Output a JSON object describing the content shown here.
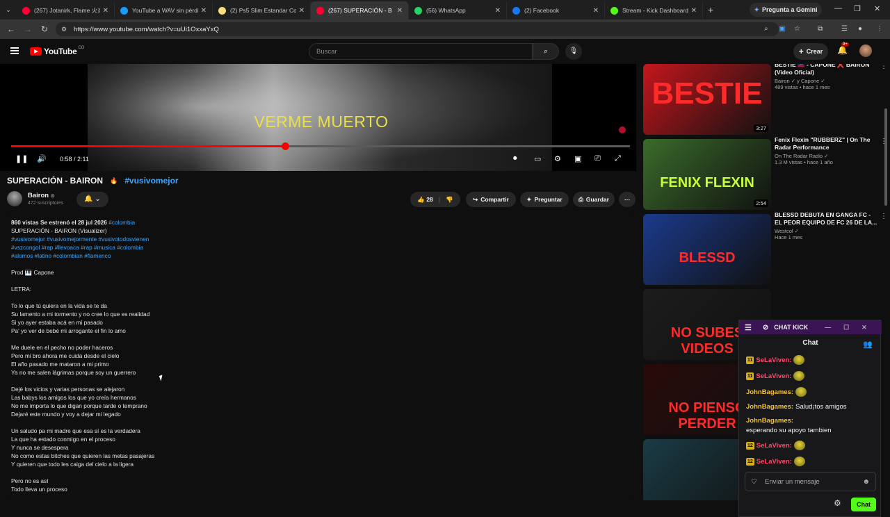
{
  "browser": {
    "tabs": [
      {
        "title": "(267) Jotanirk, Flame 火炎",
        "color": "#ff0033",
        "active": false
      },
      {
        "title": "YouTube a WAV sin pérdid",
        "color": "#1a9bfc",
        "active": false
      },
      {
        "title": "(2) Ps5 Slim Estandar Con",
        "color": "#f4e27a",
        "active": false
      },
      {
        "title": "(267) SUPERACIÓN - B",
        "color": "#ff0033",
        "active": true
      },
      {
        "title": "(56) WhatsApp",
        "color": "#25d366",
        "active": false
      },
      {
        "title": "(2) Facebook",
        "color": "#1877f2",
        "active": false
      },
      {
        "title": "Stream - Kick Dashboard",
        "color": "#53fc18",
        "active": false
      }
    ],
    "gemini_label": "Pregunta a Gemini",
    "url": "https://www.youtube.com/watch?v=uUi1OxxaYxQ"
  },
  "youtube": {
    "logo_text": "YouTube",
    "logo_country": "CO",
    "search_placeholder": "Buscar",
    "create_label": "Crear",
    "notif_count": "9+"
  },
  "player": {
    "lyric_overlay": "VERME MUERTO",
    "time": "0:58 / 2:11",
    "progress": 0.443
  },
  "video": {
    "title": "SUPERACIÓN - BAIRON",
    "hashtag": "#vusivomejor",
    "channel": "Bairon",
    "subscribers": "472 suscriptores",
    "likes": "28",
    "share_label": "Compartir",
    "ask_label": "Preguntar",
    "save_label": "Guardar"
  },
  "description": {
    "meta": "860 vistas  Se estrenó el 28 jul 2026",
    "meta_tag": "#colombia",
    "title_line": "SUPERACIÓN - BAIRON (Visualizer)",
    "hashtags": [
      "#vusivomejor #vusivomejormente #vusivotodosvienen",
      "#vszcongol #rap #llevoaca #rap #musica #colombia",
      "#alomos #latino #colombian #flamenco"
    ],
    "prod": "Prod 🎹 Capone",
    "letra": "LETRA:",
    "verses": [
      [
        "To lo que tú quiera en la vida se te da",
        "Su lamento a mi tormento y no cree lo que es realidad",
        "Si yo ayer estaba acá en mi pasado",
        "Pa' yo ver de bebé mi arrogante el fin lo amo"
      ],
      [
        "Me duele en el pecho no poder haceros",
        "Pero mi bro ahora me cuida desde el cielo",
        "El año pasado me mataron a mi primo",
        "Ya no me salen lágrimas porque soy un guerrero"
      ],
      [
        "Dejé los vicios y varias personas se alejaron",
        "Las babys los amigos los que yo creía hermanos",
        "No me importa lo que digan porque tarde o temprano",
        "Dejaré este mundo y voy a dejar mi legado"
      ],
      [
        "Un saludo pa mi madre que esa sí es la verdadera",
        "La que ha estado conmigo en el proceso",
        "Y nunca se desespera",
        "No como estas bitches que quieren las metas pasajeras",
        "Y quieren que todo les caiga del cielo a la ligera"
      ],
      [
        "Pero no es así",
        "Todo lleva un proceso"
      ]
    ]
  },
  "sidebar": [
    {
      "title": "BESTIE 🇻🇪 - CAPONE ❌ BAIRON (Video Oficial)",
      "channel": "Bairon ✓ y Capone ✓",
      "meta": "489 vistas • hace 1 mes",
      "duration": "3:27",
      "thumb_text": "BESTIE",
      "thumb_color": "#c4161c"
    },
    {
      "title": "Fenix Flexin \"RUBBERZ\" | On The Radar Performance",
      "channel": "On The Radar Radio ✓",
      "meta": "1.3 M vistas • hace 1 año",
      "duration": "2:54",
      "thumb_text": "FENIX FLEXIN",
      "thumb_color": "#3a6b2a"
    },
    {
      "title": "BLESSD DEBUTA EN GANGA FC - EL PEOR EQUIPO DE FC 26 DE LA...",
      "channel": "Westcol ✓",
      "meta": "Hace 1 mes",
      "duration": "",
      "thumb_text": "BLESSD",
      "thumb_color": "#1a3a8c"
    },
    {
      "title": "",
      "channel": "",
      "meta": "",
      "duration": "",
      "thumb_text": "NO SUBES VIDEOS",
      "thumb_color": "#1c1c1c"
    },
    {
      "title": "",
      "channel": "",
      "meta": "",
      "duration": "",
      "thumb_text": "NO PIENSO PERDER",
      "thumb_color": "#2a0a0a"
    },
    {
      "title": "",
      "channel": "",
      "meta": "",
      "duration": "",
      "thumb_text": "",
      "thumb_color": "#1a3b45"
    }
  ],
  "kick_chat": {
    "window_title": "CHAT KICK",
    "header": "Chat",
    "messages": [
      {
        "badge": "11",
        "user": "SeLaViven:",
        "user_color": "red",
        "text": "",
        "emote": true
      },
      {
        "badge": "11",
        "user": "SeLaViven:",
        "user_color": "red",
        "text": "",
        "emote": true
      },
      {
        "badge": "",
        "user": "JohnBagames:",
        "user_color": "yellow",
        "text": "",
        "emote": true
      },
      {
        "badge": "",
        "user": "JohnBagames:",
        "user_color": "yellow",
        "text": "Salud¡tos amigos",
        "emote": false
      },
      {
        "badge": "",
        "user": "JohnBagames:",
        "user_color": "yellow",
        "text": "esperando su apoyo tambien",
        "emote": false
      },
      {
        "badge": "12",
        "user": "SeLaViven:",
        "user_color": "red",
        "text": "",
        "emote": true
      },
      {
        "badge": "12",
        "user": "SeLaViven:",
        "user_color": "red",
        "text": "",
        "emote": true
      }
    ],
    "input_placeholder": "Enviar un mensaje",
    "send_label": "Chat"
  }
}
